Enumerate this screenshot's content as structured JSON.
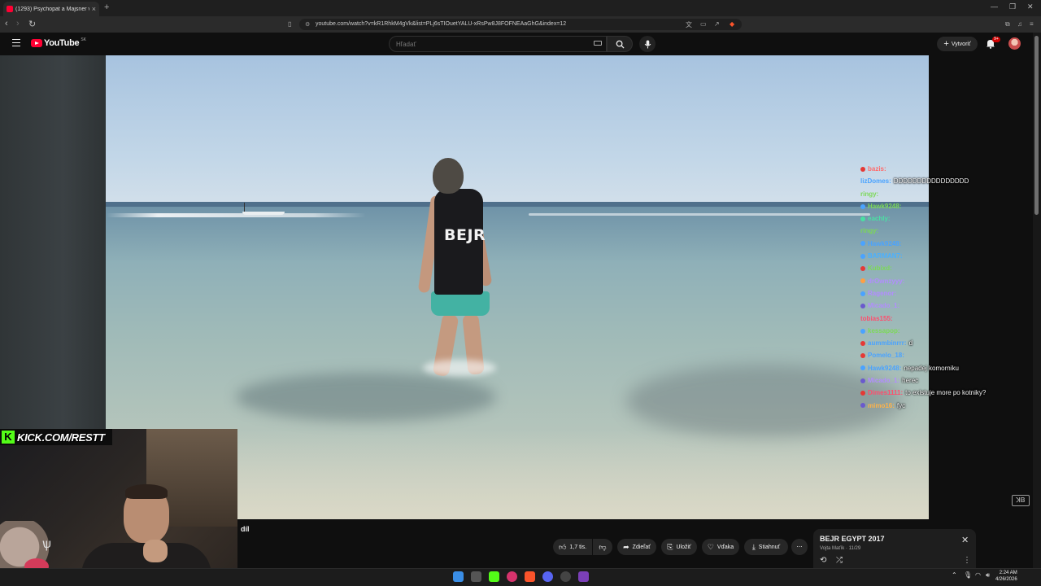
{
  "browser": {
    "tab_title": "(1293) Psychopat a Majsner v",
    "url": "youtube.com/watch?v=kR1RhkM4gVk&list=PLj6sTIOuetYALU-xRsPw8J8FOFNEAaGhG&index=12",
    "new_tab_symbol": "+",
    "tab_close_symbol": "×"
  },
  "youtube": {
    "logo_text": "YouTube",
    "country_code": "SK",
    "search_placeholder": "Hľadať",
    "create_label": "Vytvoriť",
    "notifications_count": "9+"
  },
  "video": {
    "shirt_text": "BEJR",
    "caption_fragment": "díl"
  },
  "chat": [
    {
      "user": "bazis:",
      "msg": "",
      "user_color": "#ff6b6b",
      "badge_color": "#e53935"
    },
    {
      "user": "lizDomes:",
      "msg": "DDDDDDDDDDDDDDDD",
      "user_color": "#4aa3ff",
      "badge_color": ""
    },
    {
      "user": "ringy:",
      "msg": "",
      "user_color": "#7cd957",
      "badge_color": ""
    },
    {
      "user": "Hawk9248:",
      "msg": "",
      "user_color": "#7cd957",
      "badge_color": "#4aa3ff"
    },
    {
      "user": "eachly:",
      "msg": "",
      "user_color": "#4ae0a3",
      "badge_color": "#4ae0a3"
    },
    {
      "user": "ringy:",
      "msg": "",
      "user_color": "#7cd957",
      "badge_color": ""
    },
    {
      "user": "Hawk9248:",
      "msg": "",
      "user_color": "#4aa3ff",
      "badge_color": "#4aa3ff"
    },
    {
      "user": "BARMAN7:",
      "msg": "",
      "user_color": "#4ab0ff",
      "badge_color": "#4aa3ff"
    },
    {
      "user": "Kubixd:",
      "msg": "",
      "user_color": "#7cd957",
      "badge_color": "#e53935"
    },
    {
      "user": "drOwnzyyy:",
      "msg": "",
      "user_color": "#b28cff",
      "badge_color": "#ff9f43"
    },
    {
      "user": "Ragenor:",
      "msg": "",
      "user_color": "#b28cff",
      "badge_color": "#4aa3ff"
    },
    {
      "user": "Micado_1:",
      "msg": "",
      "user_color": "#b28cff",
      "badge_color": "#6a5acd"
    },
    {
      "user": "tobias155:",
      "msg": "",
      "user_color": "#ff4d6d",
      "badge_color": ""
    },
    {
      "user": "kessapop:",
      "msg": "",
      "user_color": "#7cd957",
      "badge_color": "#4aa3ff"
    },
    {
      "user": "aummbinrrr:",
      "msg": "d",
      "user_color": "#4aa3ff",
      "badge_color": "#e53935"
    },
    {
      "user": "Pomelo_18:",
      "msg": "",
      "user_color": "#4aa3ff",
      "badge_color": "#e53935"
    },
    {
      "user": "Hawk9248:",
      "msg": "nepadej komorniku",
      "user_color": "#4aa3ff",
      "badge_color": "#4aa3ff"
    },
    {
      "user": "Micado_1:",
      "msg": "herec",
      "user_color": "#b28cff",
      "badge_color": "#6a5acd"
    },
    {
      "user": "Dimes1111:",
      "msg": "to existuje more po kotniky?",
      "user_color": "#ff4d6d",
      "badge_color": "#e53935"
    },
    {
      "user": "mimo16:",
      "msg": "fyc",
      "user_color": "#ffb347",
      "badge_color": "#6a5acd"
    }
  ],
  "webcam": {
    "kick_logo": "K",
    "kick_text": "KICK.COM/RESTT"
  },
  "actions": {
    "like_count": "1,7 tis.",
    "share_label": "Zdieľať",
    "save_label": "Uložiť",
    "thanks_label": "Vďaka",
    "download_label": "Stiahnuť",
    "more_label": "⋯"
  },
  "playlist": {
    "title": "BEJR EGYPT 2017",
    "subtitle": "Vojta Maťík · 11/29"
  },
  "taskbar": {
    "time": "2:24 AM",
    "date": "4/26/2026"
  },
  "colors": {
    "youtube_red": "#ff0033",
    "kick_green": "#53fc18",
    "shorts_teal": "#43b2a3"
  }
}
